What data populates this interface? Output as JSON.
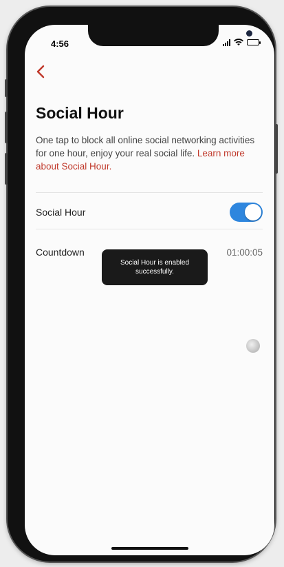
{
  "status_bar": {
    "time": "4:56"
  },
  "nav": {
    "back_icon": "chevron-left-icon",
    "accent": "#c0392b"
  },
  "page": {
    "title": "Social Hour",
    "description": "One tap to block all online social networking activities for one hour, enjoy your real social life. ",
    "learn_more_link": "Learn more about Social Hour."
  },
  "settings": {
    "social_hour_label": "Social Hour",
    "social_hour_enabled": true,
    "countdown_label": "Countdown",
    "countdown_value": "01:00:05"
  },
  "toast": {
    "message": "Social Hour is enabled successfully."
  },
  "colors": {
    "toggle_on": "#2e86de",
    "toast_bg": "#1a1a1a"
  }
}
